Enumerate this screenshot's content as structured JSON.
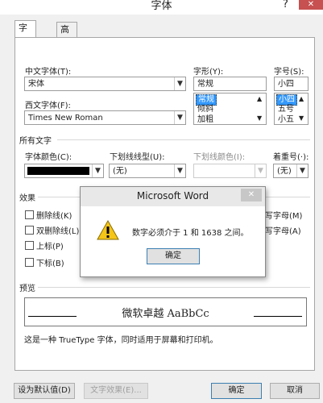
{
  "window": {
    "title": "字体",
    "help": "?",
    "close": "✕"
  },
  "tabs": [
    {
      "label": "字体(N)"
    },
    {
      "label": "高级(V)"
    }
  ],
  "font": {
    "chinese_label": "中文字体(T):",
    "chinese_value": "宋体",
    "western_label": "西文字体(F):",
    "western_value": "Times New Roman",
    "style_label": "字形(Y):",
    "style_value": "常规",
    "style_options": [
      "常规",
      "倾斜",
      "加粗"
    ],
    "size_label": "字号(S):",
    "size_value": "小四",
    "size_options": [
      "小四",
      "五号",
      "小五"
    ]
  },
  "all_text": {
    "section": "所有文字",
    "color_label": "字体颜色(C):",
    "underline_label": "下划线线型(U):",
    "underline_value": "(无)",
    "underline_color_label": "下划线颜色(I):",
    "emphasis_label": "着重号(·):",
    "emphasis_value": "(无)"
  },
  "effects": {
    "section": "效果",
    "strike": "删除线(K)",
    "double_strike": "双删除线(L)",
    "superscript": "上标(P)",
    "subscript": "下标(B)",
    "small_caps_partial": "写字母(M)",
    "all_caps_partial": "写字母(A)"
  },
  "preview": {
    "section": "预览",
    "sample": "微软卓越  AaBbCc",
    "note": "这是一种 TrueType 字体，同时适用于屏幕和打印机。"
  },
  "buttons": {
    "default": "设为默认值(D)",
    "text_effects": "文字效果(E)...",
    "ok": "确定",
    "cancel": "取消"
  },
  "dialog": {
    "title": "Microsoft Word",
    "close": "✕",
    "message": "数字必须介于 1 和 1638 之间。",
    "ok": "确定",
    "icon": "warning-icon"
  },
  "colors": {
    "accent": "#3399ff",
    "close_red": "#c75050",
    "warning": "#f5c518"
  }
}
